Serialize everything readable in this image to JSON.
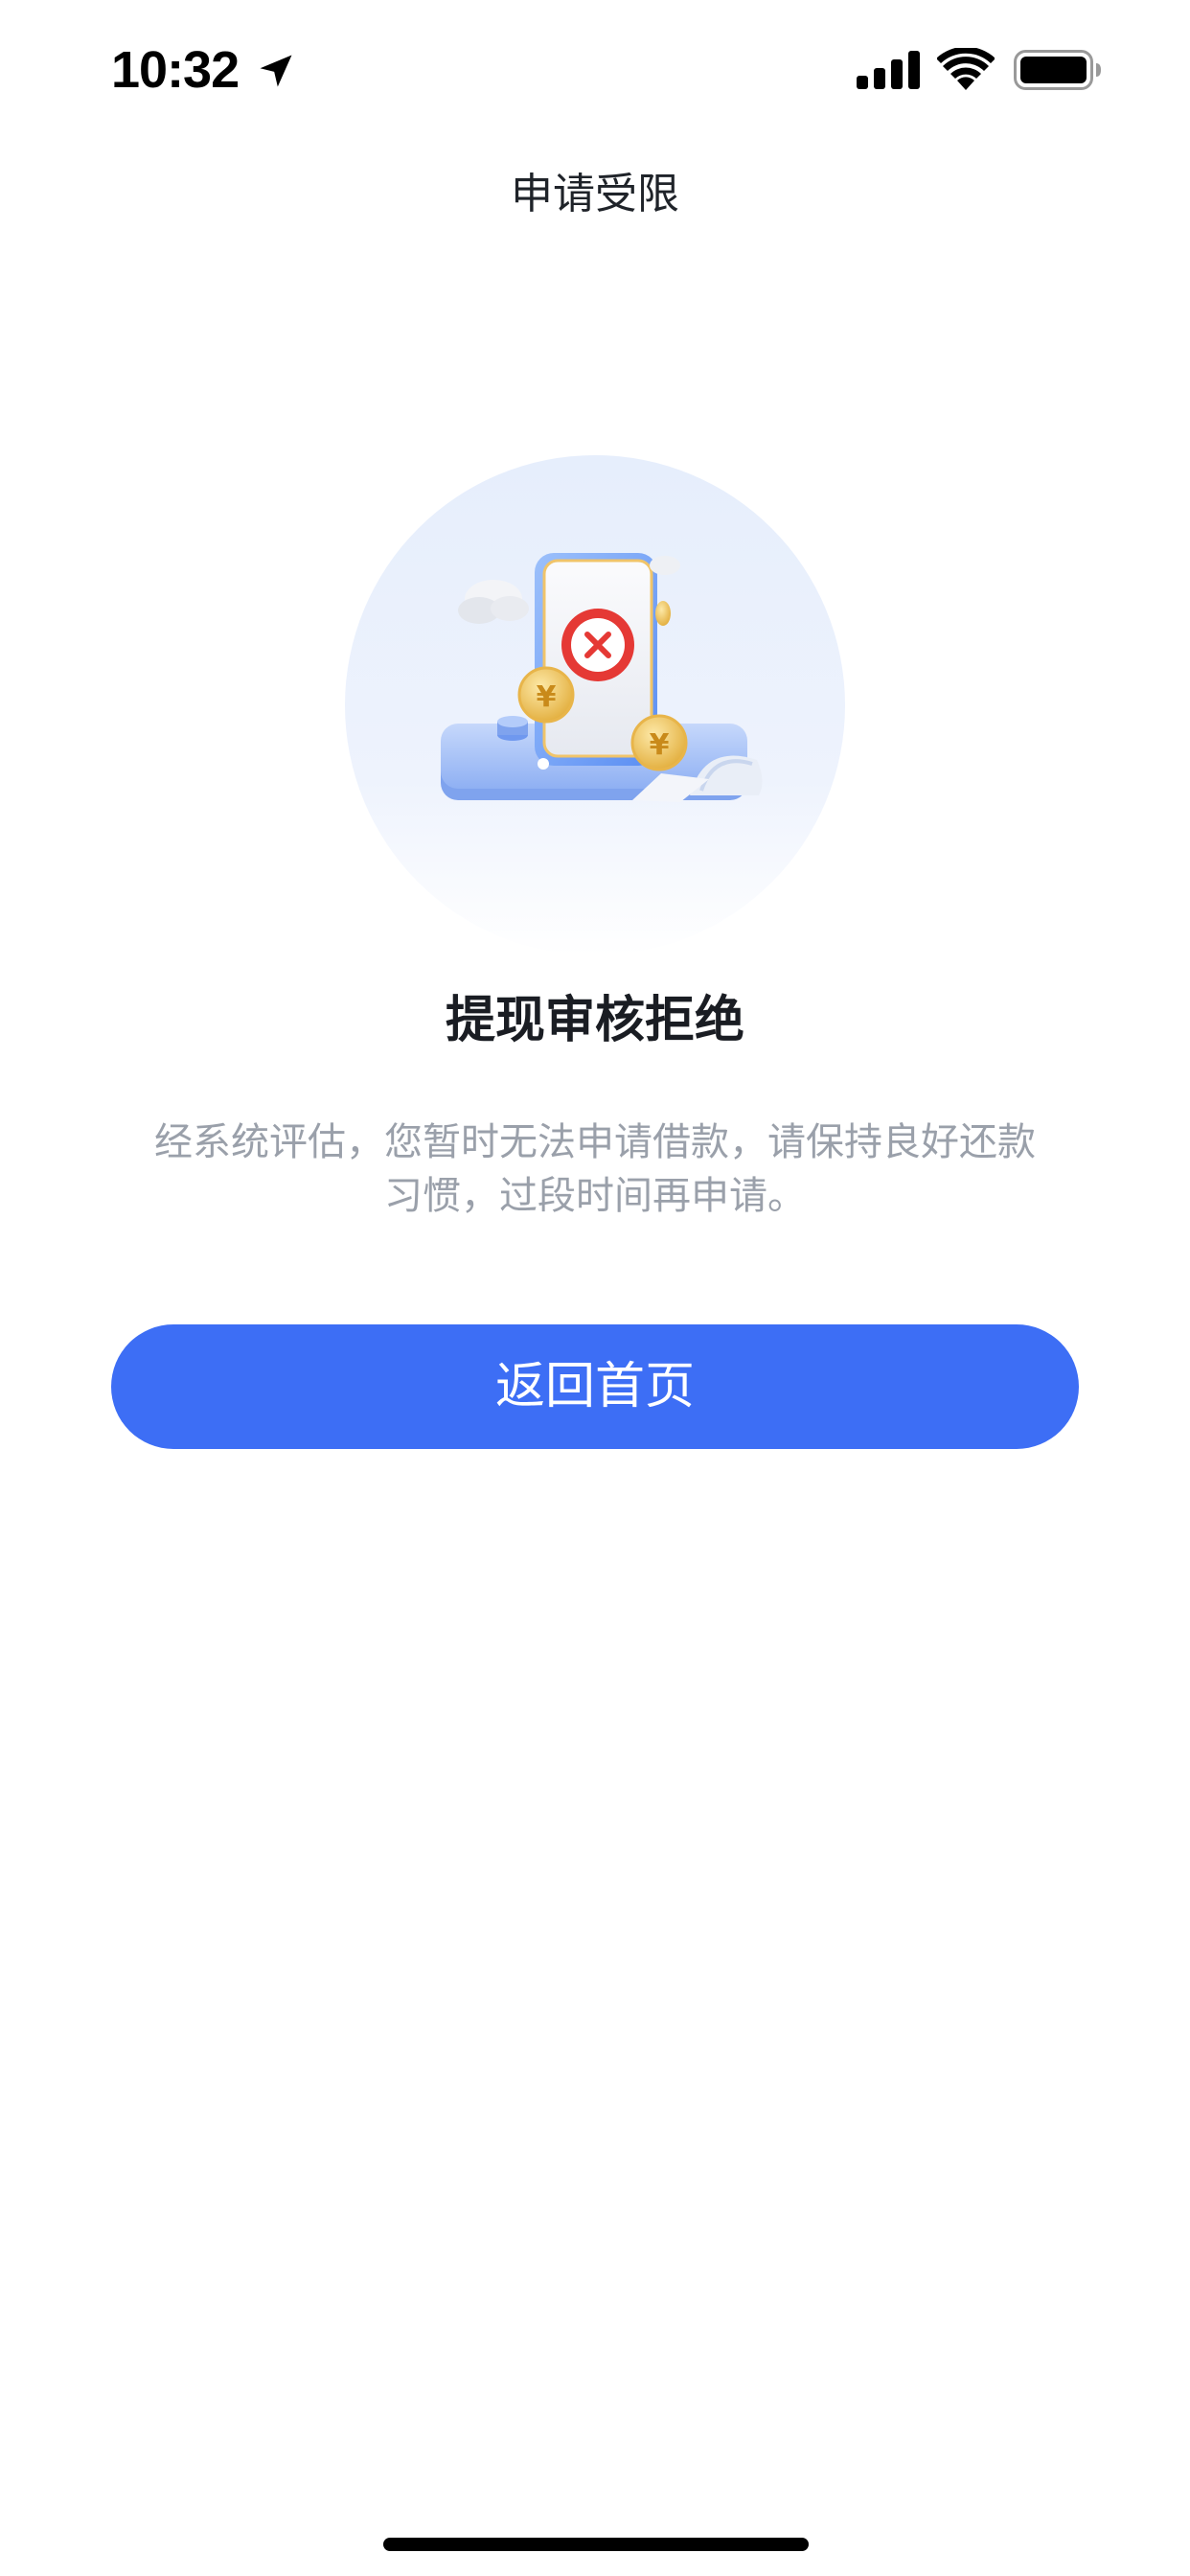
{
  "status_bar": {
    "time": "10:32",
    "icons": [
      "location-arrow-icon",
      "cellular-signal-icon",
      "wifi-icon",
      "battery-icon"
    ]
  },
  "nav": {
    "title": "申请受限"
  },
  "illustration": {
    "icon": "rejected-application-illustration",
    "accent_color": "#e53935",
    "coin_color": "#f2c14e",
    "coin_symbol": "¥"
  },
  "result": {
    "title": "提现审核拒绝",
    "description_line1": "经系统评估，您暂时无法申请借款，请保持良好还款",
    "description_line2": "习惯，过段时间再申请。"
  },
  "actions": {
    "home_button_label": "返回首页"
  },
  "colors": {
    "primary": "#3d6ef5",
    "title_text": "#1a1d23",
    "secondary_text": "#9aa0aa",
    "background": "#ffffff"
  }
}
